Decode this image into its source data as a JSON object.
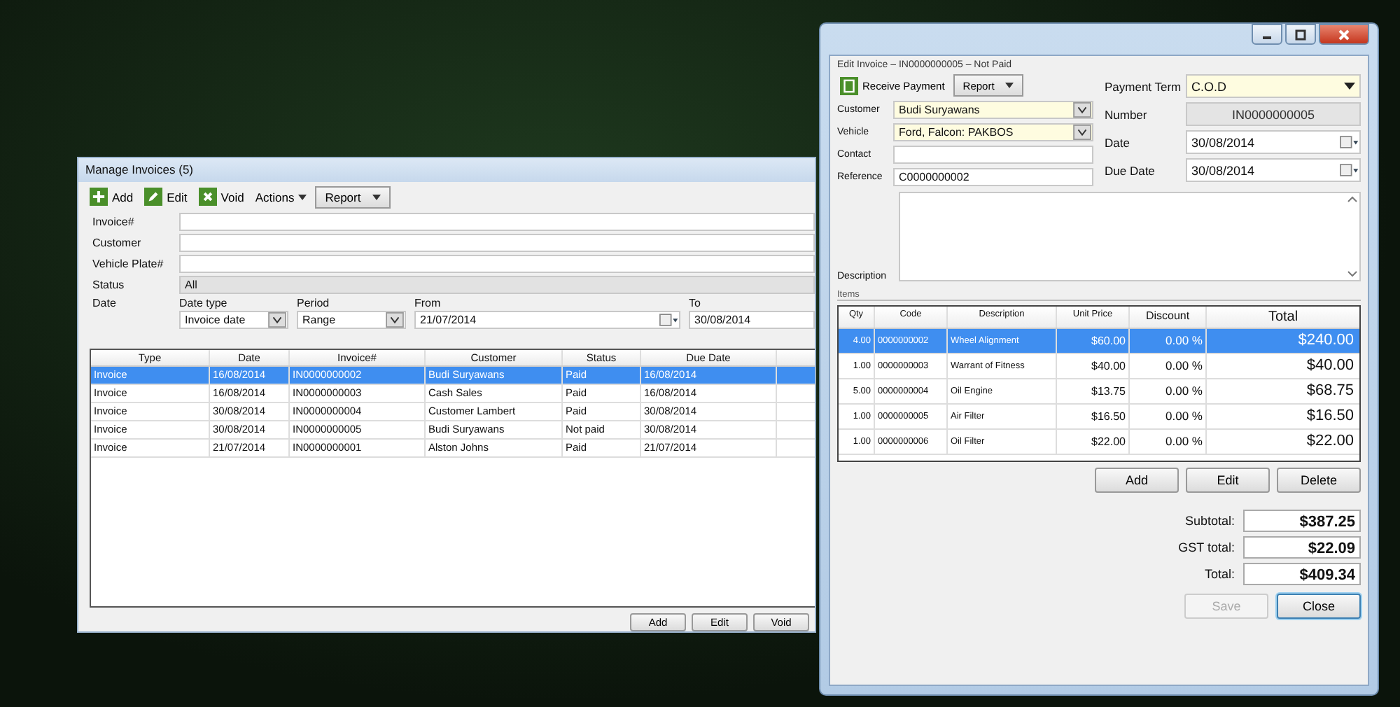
{
  "left_window": {
    "title": "Manage Invoices (5)",
    "toolbar": [
      {
        "kind": "add",
        "label": "Add"
      },
      {
        "kind": "edit",
        "label": "Edit"
      },
      {
        "kind": "void",
        "label": "Void"
      },
      {
        "kind": "menu",
        "label": "Actions"
      },
      {
        "kind": "dropdown",
        "label": "Report"
      }
    ],
    "filters": [
      {
        "kind": "text",
        "label": "Invoice#"
      },
      {
        "kind": "text",
        "label": "Customer"
      },
      {
        "kind": "text",
        "label": "Vehicle Plate#"
      },
      {
        "kind": "select",
        "label": "Status",
        "value": "All"
      }
    ],
    "date": {
      "label": "Date",
      "fields": [
        {
          "kind": "select",
          "label": "Date type",
          "value": "Invoice date"
        },
        {
          "kind": "select",
          "label": "Period",
          "value": "Range"
        },
        {
          "kind": "date",
          "label": "From",
          "value": "21/07/2014"
        },
        {
          "kind": "text",
          "label": "To",
          "value": "30/08/2014"
        }
      ]
    },
    "table": {
      "columns": [
        "Type",
        "Date",
        "Invoice#",
        "Customer",
        "Status",
        "Due Date"
      ],
      "rows": [
        {
          "selected": true,
          "cells": [
            "Invoice",
            "16/08/2014",
            "IN0000000002",
            "Budi Suryawans",
            "Paid",
            "16/08/2014"
          ]
        },
        {
          "selected": false,
          "cells": [
            "Invoice",
            "16/08/2014",
            "IN0000000003",
            "Cash Sales",
            "Paid",
            "16/08/2014"
          ]
        },
        {
          "selected": false,
          "cells": [
            "Invoice",
            "30/08/2014",
            "IN0000000004",
            "Customer Lambert",
            "Paid",
            "30/08/2014"
          ]
        },
        {
          "selected": false,
          "cells": [
            "Invoice",
            "30/08/2014",
            "IN0000000005",
            "Budi Suryawans",
            "Not paid",
            "30/08/2014"
          ]
        },
        {
          "selected": false,
          "cells": [
            "Invoice",
            "21/07/2014",
            "IN0000000001",
            "Alston Johns",
            "Paid",
            "21/07/2014"
          ]
        }
      ]
    },
    "buttons": [
      "Add",
      "Edit",
      "Void"
    ]
  },
  "right_window": {
    "title": "Edit Invoice – IN0000000005 – Not Paid",
    "toolbar": [
      {
        "kind": "payment",
        "label": "Receive Payment"
      },
      {
        "kind": "dropdown",
        "label": "Report"
      }
    ],
    "left_fields": [
      {
        "kind": "select",
        "label": "Customer",
        "value": "Budi Suryawans"
      },
      {
        "kind": "select",
        "label": "Vehicle",
        "value": "Ford, Falcon: PAKBOS"
      },
      {
        "kind": "text",
        "label": "Contact"
      },
      {
        "kind": "text",
        "label": "Reference",
        "value": "C0000000002"
      }
    ],
    "right_fields": [
      {
        "kind": "select",
        "label": "Payment Term",
        "value": "C.O.D"
      },
      {
        "kind": "readonly",
        "label": "Number",
        "value": "IN0000000005"
      },
      {
        "kind": "date",
        "label": "Date",
        "value": "30/08/2014"
      },
      {
        "kind": "date",
        "label": "Due Date",
        "value": "30/08/2014"
      }
    ],
    "description_label": "Description",
    "items_label": "Items",
    "items": {
      "columns": [
        "Qty",
        "Code",
        "Description",
        "Unit Price",
        "Discount",
        "Total"
      ],
      "rows": [
        {
          "selected": true,
          "cells": [
            "4.00",
            "0000000002",
            "Wheel Alignment",
            "$60.00",
            "0.00 %",
            "$240.00"
          ]
        },
        {
          "selected": false,
          "cells": [
            "1.00",
            "0000000003",
            "Warrant of Fitness",
            "$40.00",
            "0.00 %",
            "$40.00"
          ]
        },
        {
          "selected": false,
          "cells": [
            "5.00",
            "0000000004",
            "Oil Engine",
            "$13.75",
            "0.00 %",
            "$68.75"
          ]
        },
        {
          "selected": false,
          "cells": [
            "1.00",
            "0000000005",
            "Air Filter",
            "$16.50",
            "0.00 %",
            "$16.50"
          ]
        },
        {
          "selected": false,
          "cells": [
            "1.00",
            "0000000006",
            "Oil Filter",
            "$22.00",
            "0.00 %",
            "$22.00"
          ]
        }
      ]
    },
    "item_buttons": [
      "Add",
      "Edit",
      "Delete"
    ],
    "totals": [
      {
        "label": "Subtotal:",
        "value": "$387.25"
      },
      {
        "label": "GST total:",
        "value": "$22.09"
      },
      {
        "label": "Total:",
        "value": "$409.34"
      }
    ],
    "buttons": [
      {
        "label": "Save",
        "disabled": true
      },
      {
        "label": "Close",
        "disabled": false
      }
    ]
  }
}
